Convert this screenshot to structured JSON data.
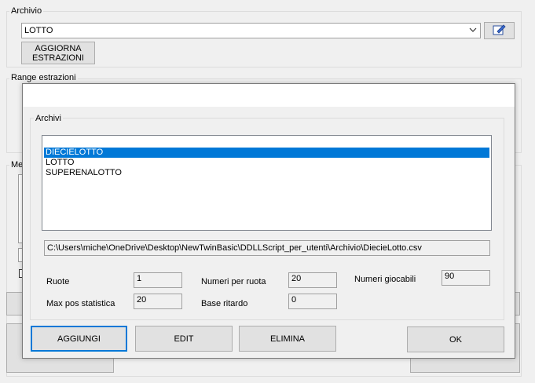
{
  "background": {
    "archivio_group_label": "Archivio",
    "archivio_select_value": "LOTTO",
    "aggiorna_button_label": "AGGIORNA\nESTRAZIONI",
    "range_group_label": "Range estrazioni",
    "partial_group_label": "Me"
  },
  "dialog": {
    "archivi_group_label": "Archivi",
    "archivi_list": [
      "DIECIELOTTO",
      "LOTTO",
      "SUPERENALOTTO"
    ],
    "selected_index": 0,
    "path_value": "C:\\Users\\miche\\OneDrive\\Desktop\\NewTwinBasic\\DDLLScript_per_utenti\\Archivio\\DiecieLotto.csv",
    "ruote_label": "Ruote",
    "ruote_value": "1",
    "numeri_per_ruota_label": "Numeri per ruota",
    "numeri_per_ruota_value": "20",
    "numeri_giocabili_label": "Numeri giocabili",
    "numeri_giocabili_value": "90",
    "max_pos_label": "Max pos statistica",
    "max_pos_value": "20",
    "base_ritardo_label": "Base ritardo",
    "base_ritardo_value": "0",
    "aggiungi_label": "AGGIUNGI",
    "edit_label": "EDIT",
    "elimina_label": "ELIMINA",
    "ok_label": "OK"
  },
  "colors": {
    "selection": "#0078d7",
    "window_bg": "#f0f0f0",
    "focus_border": "#0078d7"
  }
}
